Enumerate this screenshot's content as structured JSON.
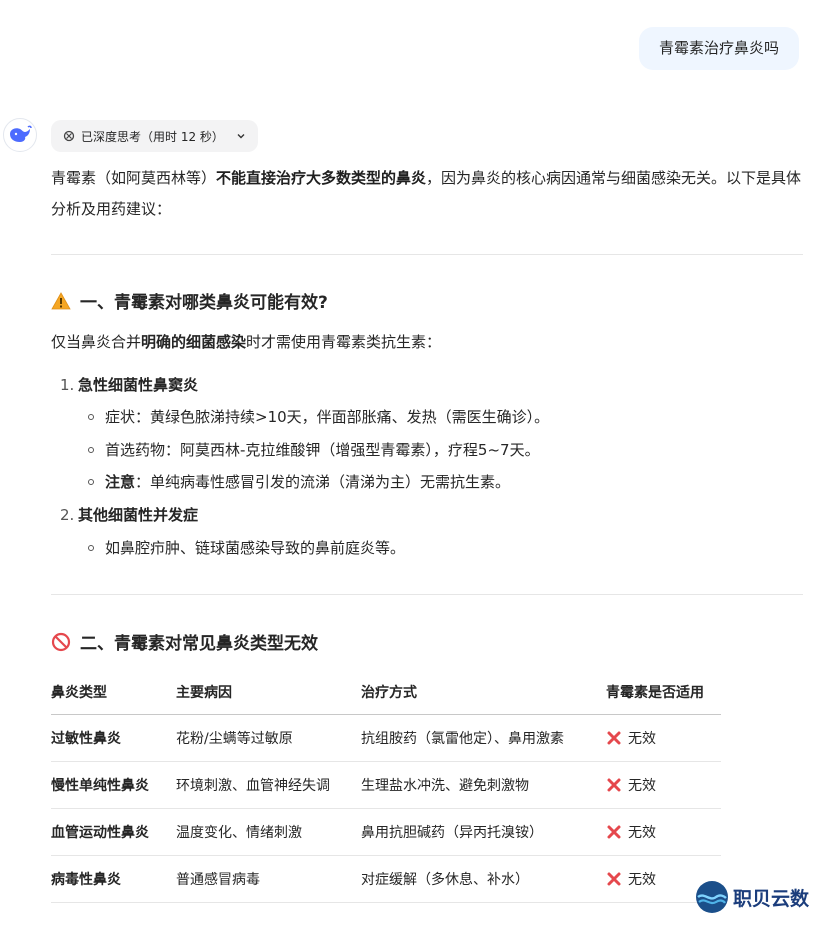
{
  "user_message": "青霉素治疗鼻炎吗",
  "thinking_chip": {
    "label": "已深度思考（用时 12 秒）"
  },
  "answer": {
    "intro_prefix": "青霉素（如阿莫西林等）",
    "intro_bold": "不能直接治疗大多数类型的鼻炎",
    "intro_suffix": "，因为鼻炎的核心病因通常与细菌感染无关。以下是具体分析及用药建议："
  },
  "section1": {
    "title": "一、青霉素对哪类鼻炎可能有效?",
    "intro_prefix": "仅当鼻炎合并",
    "intro_bold": "明确的细菌感染",
    "intro_suffix": "时才需使用青霉素类抗生素：",
    "items": [
      {
        "num": "1.",
        "title": "急性细菌性鼻窦炎",
        "bullets": [
          {
            "bold": "",
            "text": "症状：黄绿色脓涕持续>10天，伴面部胀痛、发热（需医生确诊）。"
          },
          {
            "bold": "",
            "text": "首选药物：阿莫西林-克拉维酸钾（增强型青霉素），疗程5~7天。"
          },
          {
            "bold": "注意",
            "text": "：单纯病毒性感冒引发的流涕（清涕为主）无需抗生素。"
          }
        ]
      },
      {
        "num": "2.",
        "title": "其他细菌性并发症",
        "bullets": [
          {
            "bold": "",
            "text": "如鼻腔疖肿、链球菌感染导致的鼻前庭炎等。"
          }
        ]
      }
    ]
  },
  "section2": {
    "title": "二、青霉素对常见鼻炎类型无效",
    "table": {
      "headers": [
        "鼻炎类型",
        "主要病因",
        "治疗方式",
        "青霉素是否适用"
      ],
      "rows": [
        {
          "type": "过敏性鼻炎",
          "cause": "花粉/尘螨等过敏原",
          "treatment": "抗组胺药（氯雷他定）、鼻用激素",
          "applicable": "无效"
        },
        {
          "type": "慢性单纯性鼻炎",
          "cause": "环境刺激、血管神经失调",
          "treatment": "生理盐水冲洗、避免刺激物",
          "applicable": "无效"
        },
        {
          "type": "血管运动性鼻炎",
          "cause": "温度变化、情绪刺激",
          "treatment": "鼻用抗胆碱药（异丙托溴铵）",
          "applicable": "无效"
        },
        {
          "type": "病毒性鼻炎",
          "cause": "普通感冒病毒",
          "treatment": "对症缓解（多休息、补水）",
          "applicable": "无效"
        }
      ]
    }
  },
  "watermark": {
    "text": "职贝云数"
  },
  "colors": {
    "user_bubble": "#eff6ff",
    "cross": "#e5484d",
    "brand": "#4d6bfe",
    "warning": "#f5a623",
    "prohibited": "#e5484d"
  },
  "icons": [
    "deepseek-logo-icon",
    "deep-think-icon",
    "chevron-down-icon",
    "warning-icon",
    "prohibited-icon",
    "cross-mark-icon"
  ]
}
